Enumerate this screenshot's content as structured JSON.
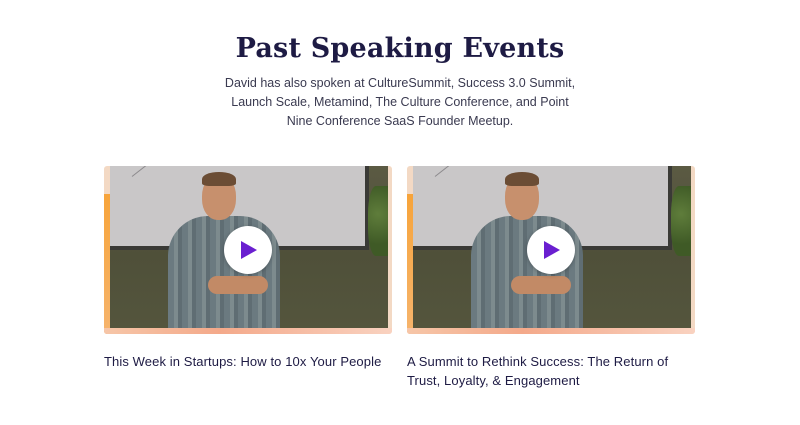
{
  "section": {
    "title": "Past Speaking Events",
    "description": "David has also spoken at CultureSummit, Success 3.0 Summit, Launch Scale, Metamind, The Culture Conference, and Point Nine Conference SaaS Founder Meetup."
  },
  "videos": [
    {
      "caption": "This Week in Startups: How to 10x Your People",
      "play_icon": "play-icon"
    },
    {
      "caption": "A Summit to Rethink Success: The Return of Trust, Loyalty, & Engagement",
      "play_icon": "play-icon"
    }
  ],
  "colors": {
    "title": "#1e1b44",
    "play_icon": "#6a1fd0",
    "accent_orange": "#f7a43a"
  }
}
